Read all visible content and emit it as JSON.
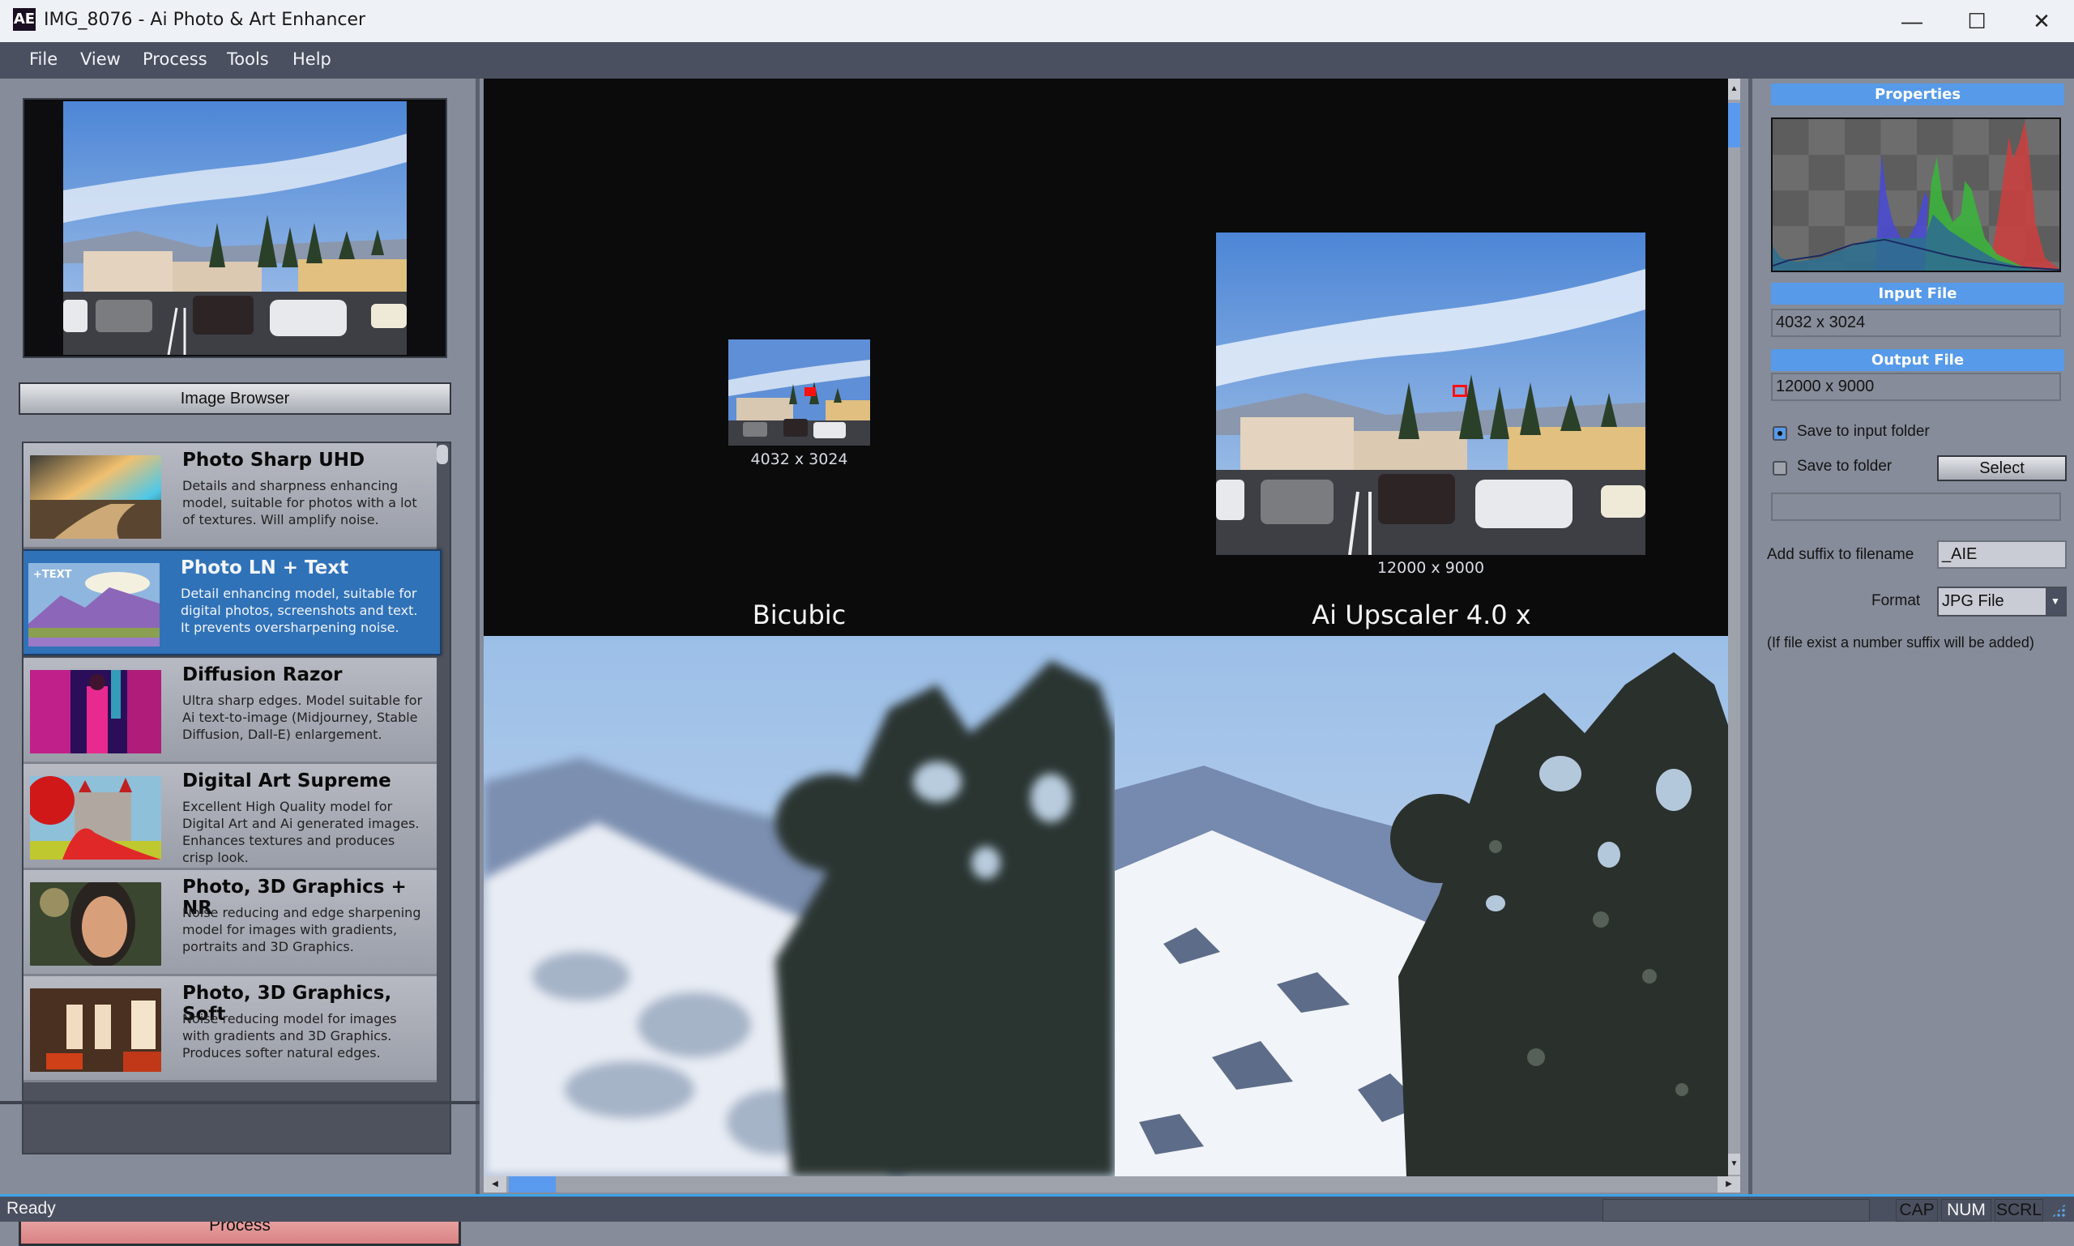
{
  "window": {
    "app_icon": "AE",
    "title": "IMG_8076 - Ai Photo & Art Enhancer",
    "controls": {
      "minimize": "—",
      "maximize": "☐",
      "close": "✕"
    }
  },
  "menu": [
    "File",
    "View",
    "Process",
    "Tools",
    "Help"
  ],
  "left_panel": {
    "image_browser_label": "Image Browser",
    "process_label": "Process",
    "models": [
      {
        "title": "Photo Sharp UHD",
        "description": "Details and sharpness enhancing model, suitable for photos with a lot of textures. Will amplify noise.",
        "selected": false,
        "thumb": "landscape-river-icon"
      },
      {
        "title": "Photo LN + Text",
        "description": "Detail enhancing model, suitable for digital photos, screenshots and text. It prevents oversharpening noise.",
        "selected": true,
        "thumb": "purple-mountains-text-icon",
        "thumb_text": "+TEXT"
      },
      {
        "title": "Diffusion Razor",
        "description": "Ultra sharp edges. Model suitable for Ai text-to-image (Midjourney, Stable Diffusion, Dall-E) enlargement.",
        "selected": false,
        "thumb": "neon-city-icon"
      },
      {
        "title": "Digital Art Supreme",
        "description": "Excellent High Quality model for Digital Art and Ai generated images. Enhances textures and produces crisp look.",
        "selected": false,
        "thumb": "castle-art-icon"
      },
      {
        "title": "Photo, 3D Graphics + NR",
        "description": "Noise reducing and edge sharpening model for images with gradients, portraits and 3D Graphics.",
        "selected": false,
        "thumb": "portrait-icon"
      },
      {
        "title": "Photo, 3D Graphics, Soft",
        "description": "Noise reducing model for images with gradients and 3D Graphics. Produces softer natural edges.",
        "selected": false,
        "thumb": "interior-room-icon"
      }
    ]
  },
  "main": {
    "bicubic": {
      "size": "4032 x 3024",
      "label": "Bicubic"
    },
    "ai": {
      "size": "12000 x 9000",
      "label": "Ai Upscaler 4.0 x"
    }
  },
  "properties": {
    "header": "Properties",
    "input_header": "Input File",
    "input_size": "4032 x 3024",
    "output_header": "Output File",
    "output_size": "12000 x 9000",
    "save_to_input_label": "Save to input folder",
    "save_to_input_checked": true,
    "save_to_folder_label": "Save to folder",
    "save_to_folder_checked": false,
    "select_label": "Select",
    "folder_value": "",
    "suffix_label": "Add suffix to filename",
    "suffix_value": "_AIE",
    "format_label": "Format",
    "format_value": "JPG File",
    "note": "(If file exist a number suffix will be added)"
  },
  "histogram": {
    "channels": [
      "red",
      "green",
      "blue",
      "luminance"
    ],
    "colors": {
      "red": "#c84040",
      "green": "#3cb23c",
      "blue": "#4a4ad0",
      "luminance": "#2f6f8f"
    }
  },
  "status": {
    "text": "Ready",
    "indicators": [
      {
        "label": "CAP",
        "active": false
      },
      {
        "label": "NUM",
        "active": true
      },
      {
        "label": "SCRL",
        "active": false
      }
    ]
  },
  "colors": {
    "accent": "#569ae9",
    "selected_item": "#3072b8",
    "process_button": "#e29a9a",
    "panel_bg": "#868c99",
    "menubar_bg": "#4b5060"
  }
}
